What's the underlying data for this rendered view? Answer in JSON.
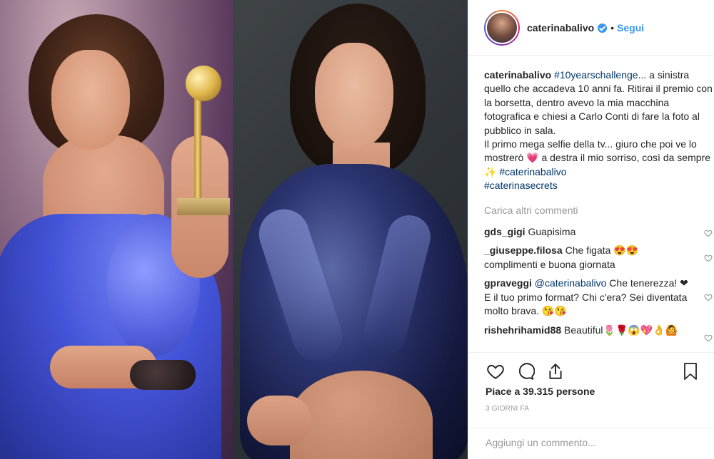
{
  "post": {
    "username": "caterinabalivo",
    "follow_label": "Segui",
    "dot": "•"
  },
  "caption": {
    "user": "caterinabalivo",
    "tag1": "#10yearschallenge",
    "text1": "... a sinistra quello che accadeva 10 anni fa. Ritirai il premio con la borsetta, dentro avevo la mia macchina fotografica e chiesi a Carlo Conti di fare la foto al pubblico in sala.",
    "text2": "Il primo mega selfie della tv... giuro che poi ve lo mostrerò 💗 a destra il mio sorriso, così da sempre ✨ ",
    "tag2": "#caterinabalivo",
    "tag3": "#caterinasecrets"
  },
  "load_more": "Carica altri commenti",
  "comments": [
    {
      "user": "gds_gigi",
      "text": "Guapisima"
    },
    {
      "user": "_giuseppe.filosa",
      "text": "Che figata 😍😍 complimenti e buona giornata"
    },
    {
      "user": "gpraveggi",
      "mention": "@caterinabalivo",
      "text": " Che tenerezza! ❤ E il tuo primo format? Chi c'era? Sei diventata molto brava. 😘😘"
    },
    {
      "user": "rishehrihamid88",
      "text": "Beautiful🌷🌹😱💖👌🙆"
    }
  ],
  "likes": "Piace a 39.315 persone",
  "time": "3 GIORNI FA",
  "add_comment_placeholder": "Aggiungi un commento...",
  "icons": [
    "heart-icon",
    "comment-icon",
    "share-icon",
    "bookmark-icon",
    "verified-badge-icon"
  ],
  "colors": {
    "link": "#3897f0",
    "hashtag": "#003569",
    "muted": "#999999",
    "text": "#262626"
  }
}
